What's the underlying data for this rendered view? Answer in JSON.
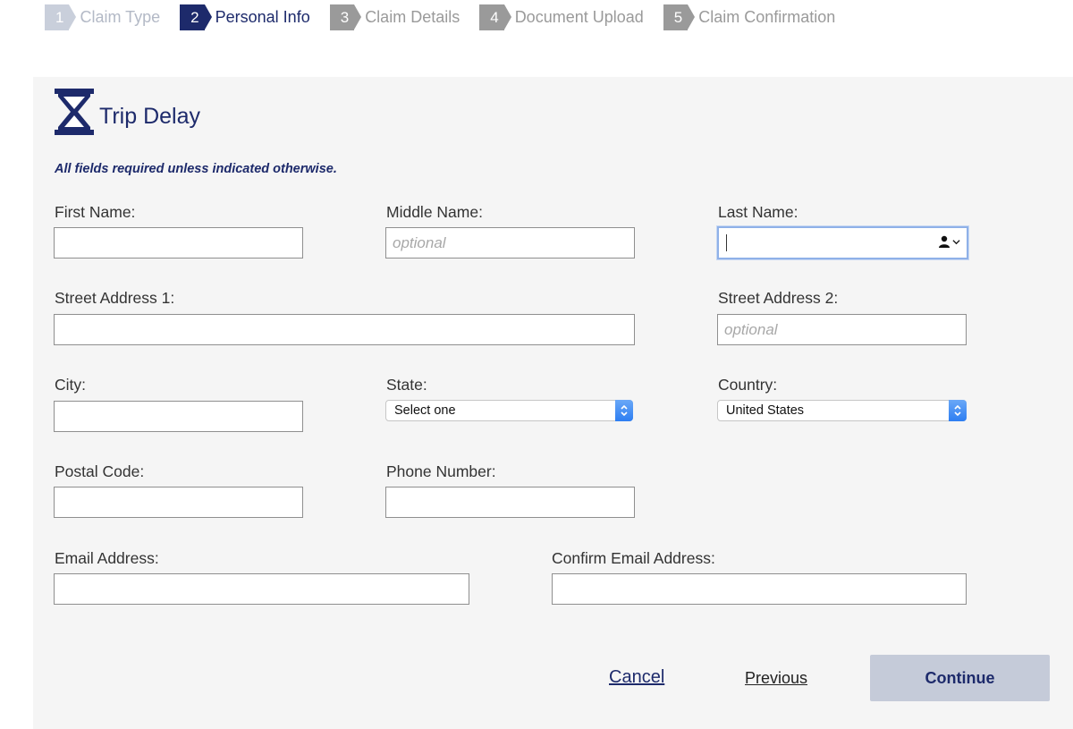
{
  "steps": [
    {
      "num": "1",
      "label": "Claim Type",
      "state": "done"
    },
    {
      "num": "2",
      "label": "Personal Info",
      "state": "active"
    },
    {
      "num": "3",
      "label": "Claim Details",
      "state": "todo"
    },
    {
      "num": "4",
      "label": "Document Upload",
      "state": "todo"
    },
    {
      "num": "5",
      "label": "Claim Confirmation",
      "state": "todo"
    }
  ],
  "header": {
    "title": "Trip Delay",
    "icon": "hourglass-icon",
    "required_note": "All fields required unless indicated otherwise."
  },
  "form": {
    "first_name": {
      "label": "First Name:",
      "value": ""
    },
    "middle_name": {
      "label": "Middle Name:",
      "value": "",
      "placeholder": "optional"
    },
    "last_name": {
      "label": "Last Name:",
      "value": ""
    },
    "street1": {
      "label": "Street Address 1:",
      "value": ""
    },
    "street2": {
      "label": "Street Address 2:",
      "value": "",
      "placeholder": "optional"
    },
    "city": {
      "label": "City:",
      "value": ""
    },
    "state": {
      "label": "State:",
      "selected": "Select one"
    },
    "country": {
      "label": "Country:",
      "selected": "United States"
    },
    "postal": {
      "label": "Postal Code:",
      "value": ""
    },
    "phone": {
      "label": "Phone Number:",
      "value": ""
    },
    "email": {
      "label": "Email Address:",
      "value": ""
    },
    "confirm_email": {
      "label": "Confirm Email Address:",
      "value": ""
    }
  },
  "actions": {
    "cancel": "Cancel",
    "previous": "Previous",
    "continue": "Continue"
  },
  "colors": {
    "brand": "#1d2a6b",
    "panel_bg": "#f5f5f5",
    "continue_bg": "#c5cbd9",
    "focus_ring": "#8fb1e8",
    "select_arrow": "#2d7ef2"
  }
}
